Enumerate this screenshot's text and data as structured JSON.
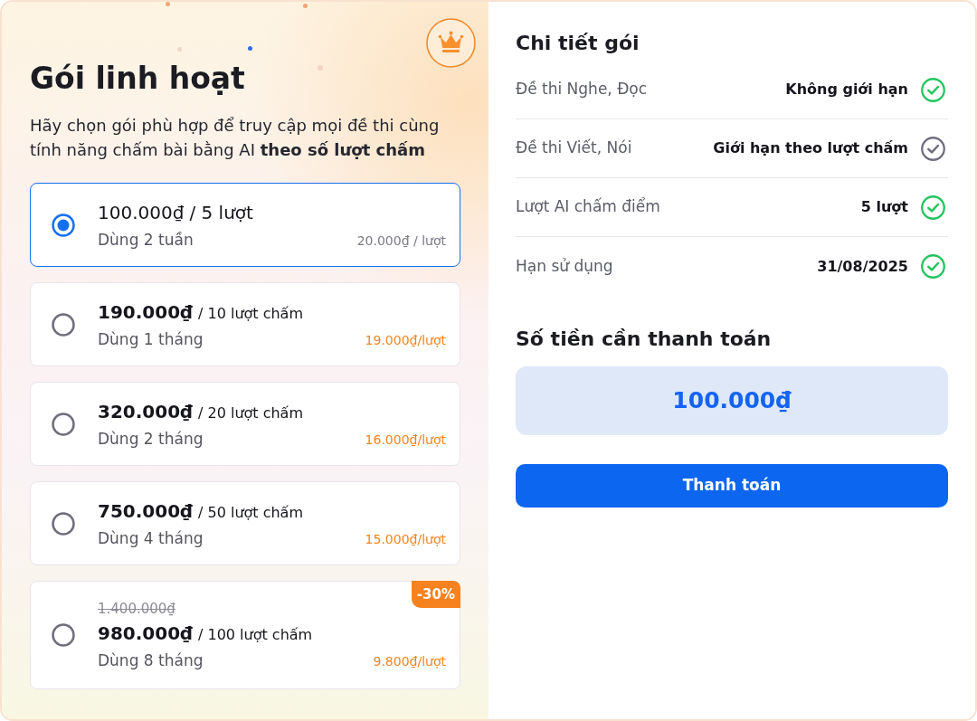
{
  "promo": {
    "title": "Gói linh hoạt",
    "description": "Hãy chọn gói phù hợp để truy cập mọi đề thi cùng tính năng chấm bài bằng AI **theo số lượt chấm**"
  },
  "plans": [
    {
      "price": "100.000₫",
      "quota": "/ 5 lượt",
      "duration": "Dùng 2 tuần",
      "per_use": "20.000₫ / lượt",
      "selected": true
    },
    {
      "price": "190.000₫",
      "quota": "/ 10 lượt chấm",
      "duration": "Dùng 1 tháng",
      "per_use": "19.000₫/lượt",
      "selected": false
    },
    {
      "price": "320.000₫",
      "quota": "/ 20 lượt chấm",
      "duration": "Dùng 2 tháng",
      "per_use": "16.000₫/lượt",
      "selected": false
    },
    {
      "price": "750.000₫",
      "quota": "/ 50 lượt chấm",
      "duration": "Dùng 4 tháng",
      "per_use": "15.000₫/lượt",
      "selected": false
    },
    {
      "original_price": "1.400.000₫",
      "discount": "-30%",
      "price": "980.000₫",
      "quota": "/ 100 lượt chấm",
      "duration": "Dùng 8 tháng",
      "per_use": "9.800₫/lượt",
      "selected": false
    }
  ],
  "details": {
    "title": "Chi tiết gói",
    "rows": [
      {
        "label": "Đề thi Nghe, Đọc",
        "value": "Không giới hạn",
        "limited": false
      },
      {
        "label": "Đề thi Viết, Nói",
        "value": "Giới hạn theo lượt chấm",
        "limited": true
      },
      {
        "label": "Lượt AI chấm điểm",
        "value": "5 lượt",
        "limited": false
      },
      {
        "label": "Hạn sử dụng",
        "value": "31/08/2025",
        "limited": false
      }
    ]
  },
  "payment": {
    "title": "Số tiền cần thanh toán",
    "amount": "100.000₫",
    "button": "Thanh toán"
  }
}
